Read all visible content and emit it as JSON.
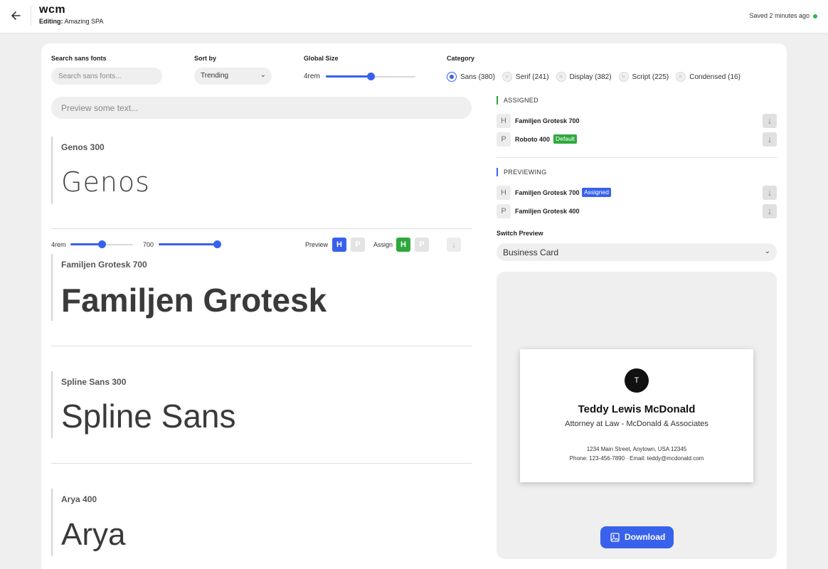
{
  "header": {
    "app_name": "wcm",
    "editing_label": "Editing:",
    "project_name": "Amazing SPA",
    "saved_status": "Saved 2 minutes ago",
    "status_color": "#2fb84a"
  },
  "controls": {
    "search_label": "Search sans fonts",
    "search_placeholder": "Search sans fonts...",
    "sort_label": "Sort by",
    "sort_value": "Trending",
    "size_label": "Global Size",
    "size_value": "4rem",
    "size_level": 0.5,
    "category_label": "Category",
    "categories": [
      {
        "label": "Sans (380)",
        "selected": true
      },
      {
        "label": "Serif (241)",
        "selected": false
      },
      {
        "label": "Display (382)",
        "selected": false
      },
      {
        "label": "Script (225)",
        "selected": false
      },
      {
        "label": "Condensed (16)",
        "selected": false
      }
    ]
  },
  "preview_placeholder": "Preview some text...",
  "fonts": [
    {
      "name": "Genos 300",
      "sample": "Genos"
    },
    {
      "name": "Familjen Grotesk 700",
      "sample": "Familjen Grotesk"
    },
    {
      "name": "Spline Sans 300",
      "sample": "Spline Sans"
    },
    {
      "name": "Arya 400",
      "sample": "Arya"
    }
  ],
  "row_controls": {
    "size": "4rem",
    "size_level": 0.5,
    "weight": "700",
    "weight_level": 1.0,
    "preview_label": "Preview",
    "assign_label": "Assign",
    "h": "H",
    "p": "P"
  },
  "assigned": {
    "title": "ASSIGNED",
    "rows": [
      {
        "letter": "H",
        "font": "Familjen Grotesk 700"
      },
      {
        "letter": "P",
        "font": "Roboto 400",
        "badge": "Default"
      }
    ]
  },
  "previewing": {
    "title": "PREVIEWING",
    "rows": [
      {
        "letter": "H",
        "font": "Familjen Grotesk 700",
        "badge": "Assigned"
      },
      {
        "letter": "P",
        "font": "Familjen Grotesk 400"
      }
    ]
  },
  "switch_preview": {
    "label": "Switch Preview",
    "value": "Business Card"
  },
  "business_card": {
    "initial": "T",
    "name": "Teddy Lewis McDonald",
    "title": "Attorney at Law - McDonald & Associates",
    "address": "1234 Main Street, Anytown, USA 12345",
    "contact": "Phone: 123-456-7890 · Email: teddy@mcdonald.com"
  },
  "download_label": "Download",
  "colors": {
    "accent_blue": "#3861ec",
    "accent_green": "#2fa83c"
  }
}
